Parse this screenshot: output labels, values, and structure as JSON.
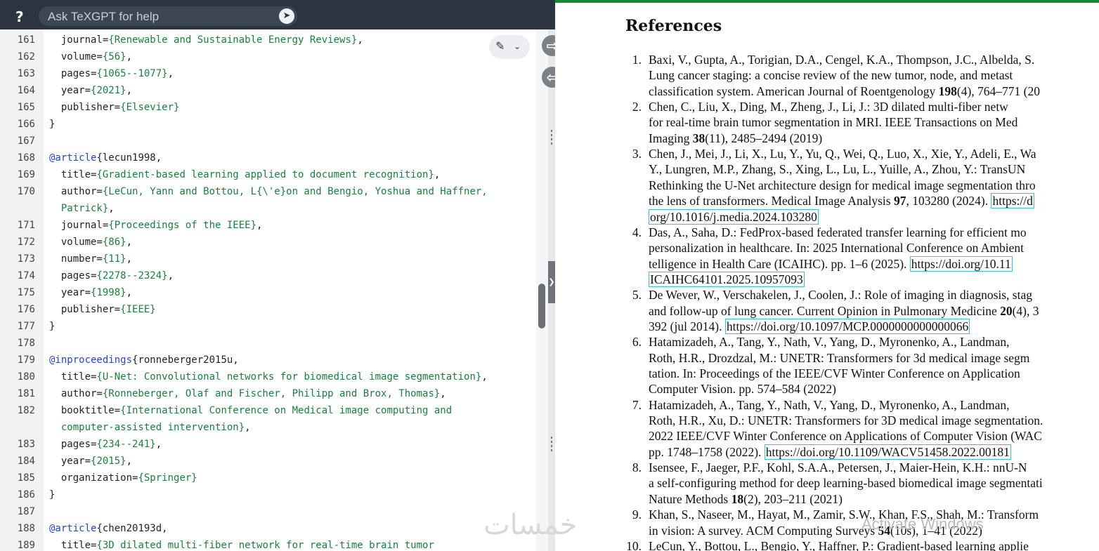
{
  "topbar": {
    "help_label": "?",
    "ask_placeholder": "Ask TeXGPT for help",
    "send_icon": "send-icon"
  },
  "editor": {
    "line_numbers": [
      "161",
      "162",
      "163",
      "164",
      "165",
      "166",
      "167",
      "168",
      "169",
      "170",
      "",
      "171",
      "172",
      "173",
      "174",
      "175",
      "176",
      "177",
      "178",
      "179",
      "180",
      "181",
      "182",
      "",
      "183",
      "184",
      "185",
      "186",
      "187",
      "188",
      "189"
    ],
    "lines": [
      [
        [
          "  journal=",
          ""
        ],
        [
          "{Renewable and Sustainable Energy Reviews}",
          "str"
        ],
        [
          ",",
          ""
        ]
      ],
      [
        [
          "  volume=",
          ""
        ],
        [
          "{56}",
          "str"
        ],
        [
          ",",
          ""
        ]
      ],
      [
        [
          "  pages=",
          ""
        ],
        [
          "{1065--1077}",
          "str"
        ],
        [
          ",",
          ""
        ]
      ],
      [
        [
          "  year=",
          ""
        ],
        [
          "{2021}",
          "str"
        ],
        [
          ",",
          ""
        ]
      ],
      [
        [
          "  publisher=",
          ""
        ],
        [
          "{Elsevier}",
          "str"
        ]
      ],
      [
        [
          "}",
          ""
        ]
      ],
      [],
      [
        [
          "@article",
          "kw"
        ],
        [
          "{lecun1998,",
          ""
        ]
      ],
      [
        [
          "  title=",
          ""
        ],
        [
          "{Gradient-based learning applied to document recognition}",
          "str"
        ],
        [
          ",",
          ""
        ]
      ],
      [
        [
          "  author=",
          ""
        ],
        [
          "{LeCun, Yann and Bottou, L{\\'e}on and Bengio, Yoshua and Haffner,",
          "str"
        ]
      ],
      [
        [
          "  Patrick}",
          "str"
        ],
        [
          ",",
          ""
        ]
      ],
      [
        [
          "  journal=",
          ""
        ],
        [
          "{Proceedings of the IEEE}",
          "str"
        ],
        [
          ",",
          ""
        ]
      ],
      [
        [
          "  volume=",
          ""
        ],
        [
          "{86}",
          "str"
        ],
        [
          ",",
          ""
        ]
      ],
      [
        [
          "  number=",
          ""
        ],
        [
          "{11}",
          "str"
        ],
        [
          ",",
          ""
        ]
      ],
      [
        [
          "  pages=",
          ""
        ],
        [
          "{2278--2324}",
          "str"
        ],
        [
          ",",
          ""
        ]
      ],
      [
        [
          "  year=",
          ""
        ],
        [
          "{1998}",
          "str"
        ],
        [
          ",",
          ""
        ]
      ],
      [
        [
          "  publisher=",
          ""
        ],
        [
          "{IEEE}",
          "str"
        ]
      ],
      [
        [
          "}",
          ""
        ]
      ],
      [],
      [
        [
          "@inproceedings",
          "kw"
        ],
        [
          "{ronneberger2015u,",
          ""
        ]
      ],
      [
        [
          "  title=",
          ""
        ],
        [
          "{U-Net: Convolutional networks for biomedical image segmentation}",
          "str"
        ],
        [
          ",",
          ""
        ]
      ],
      [
        [
          "  author=",
          ""
        ],
        [
          "{Ronneberger, Olaf and Fischer, Philipp and Brox, Thomas}",
          "str"
        ],
        [
          ",",
          ""
        ]
      ],
      [
        [
          "  booktitle=",
          ""
        ],
        [
          "{International Conference on Medical image computing and",
          "str"
        ]
      ],
      [
        [
          "  computer-assisted intervention}",
          "str"
        ],
        [
          ",",
          ""
        ]
      ],
      [
        [
          "  pages=",
          ""
        ],
        [
          "{234--241}",
          "str"
        ],
        [
          ",",
          ""
        ]
      ],
      [
        [
          "  year=",
          ""
        ],
        [
          "{2015}",
          "str"
        ],
        [
          ",",
          ""
        ]
      ],
      [
        [
          "  organization=",
          ""
        ],
        [
          "{Springer}",
          "str"
        ]
      ],
      [
        [
          "}",
          ""
        ]
      ],
      [],
      [
        [
          "@article",
          "kw"
        ],
        [
          "{chen20193d,",
          ""
        ]
      ],
      [
        [
          "  title=",
          ""
        ],
        [
          "{3D dilated multi-fiber network for real-time brain tumor",
          "str"
        ]
      ]
    ]
  },
  "pdf": {
    "heading": "References",
    "refs": [
      {
        "num": "1.",
        "lines": [
          [
            "Baxi, V., Gupta, A., Torigian, D.A., Cengel, K.A., Thompson, J.C., Albelda, S."
          ],
          [
            "Lung cancer staging: a concise review of the new tumor, node, and metast"
          ],
          [
            "classification system. American Journal of Roentgenology **198**(4), 764–771 (20"
          ]
        ]
      },
      {
        "num": "2.",
        "lines": [
          [
            "Chen, C., Liu, X., Ding, M., Zheng, J., Li, J.: 3D dilated multi-fiber netw"
          ],
          [
            "for real-time brain tumor segmentation in MRI. IEEE Transactions on Med"
          ],
          [
            "Imaging **38**(11), 2485–2494 (2019)"
          ]
        ]
      },
      {
        "num": "3.",
        "lines": [
          [
            "Chen, J., Mei, J., Li, X., Lu, Y., Yu, Q., Wei, Q., Luo, X., Xie, Y., Adeli, E., Wa"
          ],
          [
            "Y., Lungren, M.P., Zhang, S., Xing, L., Lu, L., Yuille, A., Zhou, Y.: TransUN"
          ],
          [
            "Rethinking the U-Net architecture design for medical image segmentation thro"
          ],
          [
            "the lens of transformers. Medical Image Analysis **97**, 103280 (2024). ",
            "[[https://d"
          ],
          [
            "[[org/10.1016/j.media.2024.103280"
          ]
        ]
      },
      {
        "num": "4.",
        "lines": [
          [
            "Das, A., Saha, D.: FedProx-based federated transfer learning for efficient mo"
          ],
          [
            "personalization in healthcare. In: 2025 International Conference on Ambient"
          ],
          [
            "telligence in Health Care (ICAIHC). pp. 1–6 (2025). ",
            "[[https://doi.org/10.11"
          ],
          [
            "[[ICAIHC64101.2025.10957093"
          ]
        ]
      },
      {
        "num": "5.",
        "lines": [
          [
            "De Wever, W., Verschakelen, J., Coolen, J.: Role of imaging in diagnosis, stag"
          ],
          [
            "and follow-up of lung cancer. Current Opinion in Pulmonary Medicine **20**(4), 3"
          ],
          [
            "392 (jul 2014). ",
            "[[https://doi.org/10.1097/MCP.0000000000000066"
          ]
        ]
      },
      {
        "num": "6.",
        "lines": [
          [
            "Hatamizadeh, A., Tang, Y., Nath, V., Yang, D., Myronenko, A., Landman,"
          ],
          [
            "Roth, H.R., Drozdzal, M.: UNETR: Transformers for 3d medical image segm"
          ],
          [
            "tation. In: Proceedings of the IEEE/CVF Winter Conference on Application"
          ],
          [
            "Computer Vision. pp. 574–584 (2022)"
          ]
        ]
      },
      {
        "num": "7.",
        "lines": [
          [
            "Hatamizadeh, A., Tang, Y., Nath, V., Yang, D., Myronenko, A., Landman,"
          ],
          [
            "Roth, H.R., Xu, D.: UNETR: Transformers for 3D medical image segmentation."
          ],
          [
            "2022 IEEE/CVF Winter Conference on Applications of Computer Vision (WAC"
          ],
          [
            "pp. 1748–1758 (2022). ",
            "[[https://doi.org/10.1109/WACV51458.2022.00181"
          ]
        ]
      },
      {
        "num": "8.",
        "lines": [
          [
            "Isensee, F., Jaeger, P.F., Kohl, S.A.A., Petersen, J., Maier-Hein, K.H.: nnU-N"
          ],
          [
            "a self-configuring method for deep learning-based biomedical image segmentati"
          ],
          [
            "Nature Methods **18**(2), 203–211 (2021)"
          ]
        ]
      },
      {
        "num": "9.",
        "lines": [
          [
            "Khan, S., Naseer, M., Hayat, M., Zamir, S.W., Khan, F.S., Shah, M.: Transform"
          ],
          [
            "in vision: A survey. ACM Computing Surveys **54**(10s), 1–41 (2022)"
          ]
        ]
      },
      {
        "num": "10.",
        "lines": [
          [
            "LeCun, Y., Bottou, L., Bengio, Y., Haffner, P.: Gradient-based learning applie"
          ]
        ]
      }
    ]
  },
  "watermark": "Activate Windows",
  "logo": "خمسات"
}
